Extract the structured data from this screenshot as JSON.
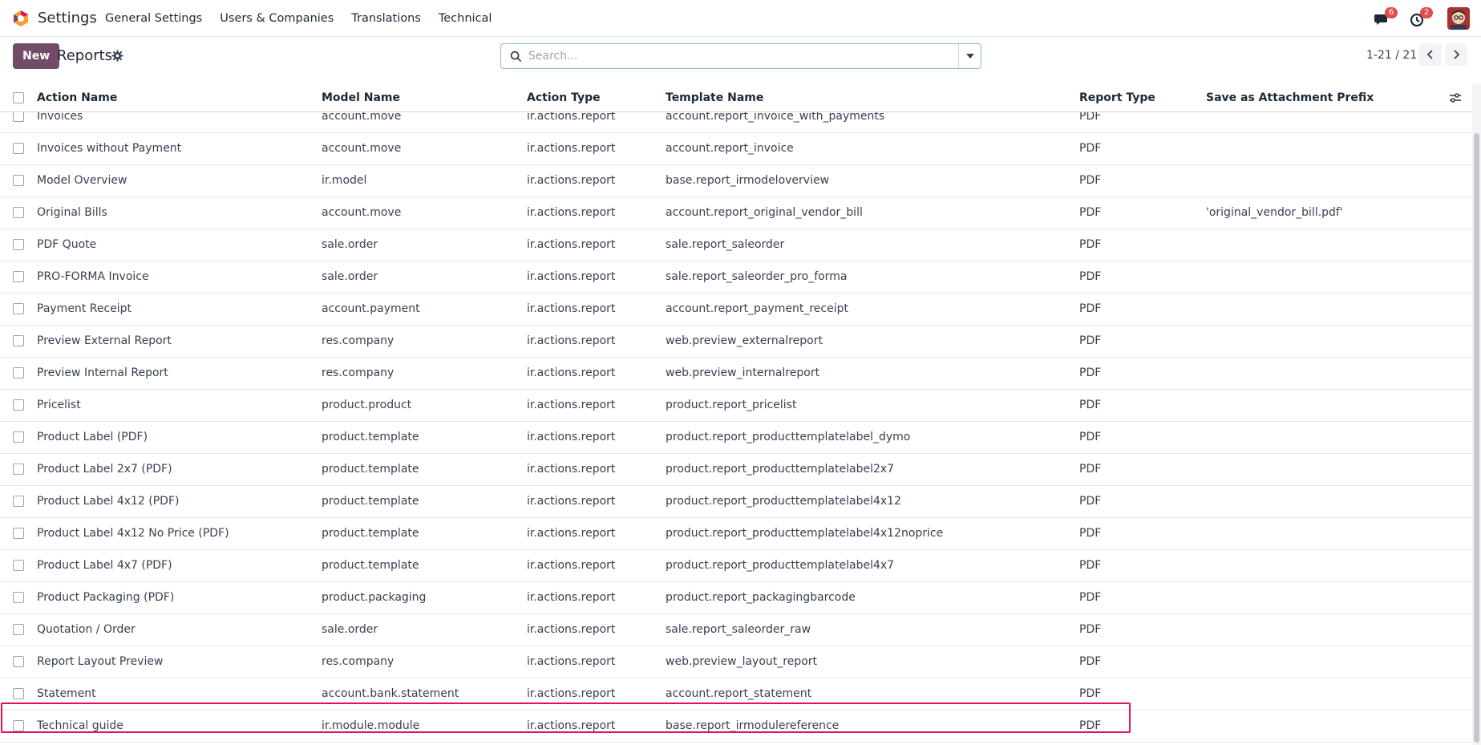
{
  "navbar": {
    "app_title": "Settings",
    "menu": [
      "General Settings",
      "Users & Companies",
      "Translations",
      "Technical"
    ],
    "messages_badge": "6",
    "activities_badge": "2"
  },
  "control_panel": {
    "new_label": "New",
    "breadcrumb": "Reports",
    "search_placeholder": "Search...",
    "pager": "1-21 / 21"
  },
  "columns": {
    "action_name": "Action Name",
    "model_name": "Model Name",
    "action_type": "Action Type",
    "template_name": "Template Name",
    "report_type": "Report Type",
    "prefix": "Save as Attachment Prefix"
  },
  "rows": [
    {
      "name": "Invoices",
      "model": "account.move",
      "type": "ir.actions.report",
      "template": "account.report_invoice_with_payments",
      "report": "PDF",
      "prefix": ""
    },
    {
      "name": "Invoices without Payment",
      "model": "account.move",
      "type": "ir.actions.report",
      "template": "account.report_invoice",
      "report": "PDF",
      "prefix": ""
    },
    {
      "name": "Model Overview",
      "model": "ir.model",
      "type": "ir.actions.report",
      "template": "base.report_irmodeloverview",
      "report": "PDF",
      "prefix": ""
    },
    {
      "name": "Original Bills",
      "model": "account.move",
      "type": "ir.actions.report",
      "template": "account.report_original_vendor_bill",
      "report": "PDF",
      "prefix": "'original_vendor_bill.pdf'"
    },
    {
      "name": "PDF Quote",
      "model": "sale.order",
      "type": "ir.actions.report",
      "template": "sale.report_saleorder",
      "report": "PDF",
      "prefix": ""
    },
    {
      "name": "PRO-FORMA Invoice",
      "model": "sale.order",
      "type": "ir.actions.report",
      "template": "sale.report_saleorder_pro_forma",
      "report": "PDF",
      "prefix": ""
    },
    {
      "name": "Payment Receipt",
      "model": "account.payment",
      "type": "ir.actions.report",
      "template": "account.report_payment_receipt",
      "report": "PDF",
      "prefix": ""
    },
    {
      "name": "Preview External Report",
      "model": "res.company",
      "type": "ir.actions.report",
      "template": "web.preview_externalreport",
      "report": "PDF",
      "prefix": ""
    },
    {
      "name": "Preview Internal Report",
      "model": "res.company",
      "type": "ir.actions.report",
      "template": "web.preview_internalreport",
      "report": "PDF",
      "prefix": ""
    },
    {
      "name": "Pricelist",
      "model": "product.product",
      "type": "ir.actions.report",
      "template": "product.report_pricelist",
      "report": "PDF",
      "prefix": ""
    },
    {
      "name": "Product Label (PDF)",
      "model": "product.template",
      "type": "ir.actions.report",
      "template": "product.report_producttemplatelabel_dymo",
      "report": "PDF",
      "prefix": ""
    },
    {
      "name": "Product Label 2x7 (PDF)",
      "model": "product.template",
      "type": "ir.actions.report",
      "template": "product.report_producttemplatelabel2x7",
      "report": "PDF",
      "prefix": ""
    },
    {
      "name": "Product Label 4x12 (PDF)",
      "model": "product.template",
      "type": "ir.actions.report",
      "template": "product.report_producttemplatelabel4x12",
      "report": "PDF",
      "prefix": ""
    },
    {
      "name": "Product Label 4x12 No Price (PDF)",
      "model": "product.template",
      "type": "ir.actions.report",
      "template": "product.report_producttemplatelabel4x12noprice",
      "report": "PDF",
      "prefix": ""
    },
    {
      "name": "Product Label 4x7 (PDF)",
      "model": "product.template",
      "type": "ir.actions.report",
      "template": "product.report_producttemplatelabel4x7",
      "report": "PDF",
      "prefix": ""
    },
    {
      "name": "Product Packaging (PDF)",
      "model": "product.packaging",
      "type": "ir.actions.report",
      "template": "product.report_packagingbarcode",
      "report": "PDF",
      "prefix": ""
    },
    {
      "name": "Quotation / Order",
      "model": "sale.order",
      "type": "ir.actions.report",
      "template": "sale.report_saleorder_raw",
      "report": "PDF",
      "prefix": ""
    },
    {
      "name": "Report Layout Preview",
      "model": "res.company",
      "type": "ir.actions.report",
      "template": "web.preview_layout_report",
      "report": "PDF",
      "prefix": ""
    },
    {
      "name": "Statement",
      "model": "account.bank.statement",
      "type": "ir.actions.report",
      "template": "account.report_statement",
      "report": "PDF",
      "prefix": ""
    },
    {
      "name": "Technical guide",
      "model": "ir.module.module",
      "type": "ir.actions.report",
      "template": "base.report_irmodulereference",
      "report": "PDF",
      "prefix": ""
    }
  ]
}
